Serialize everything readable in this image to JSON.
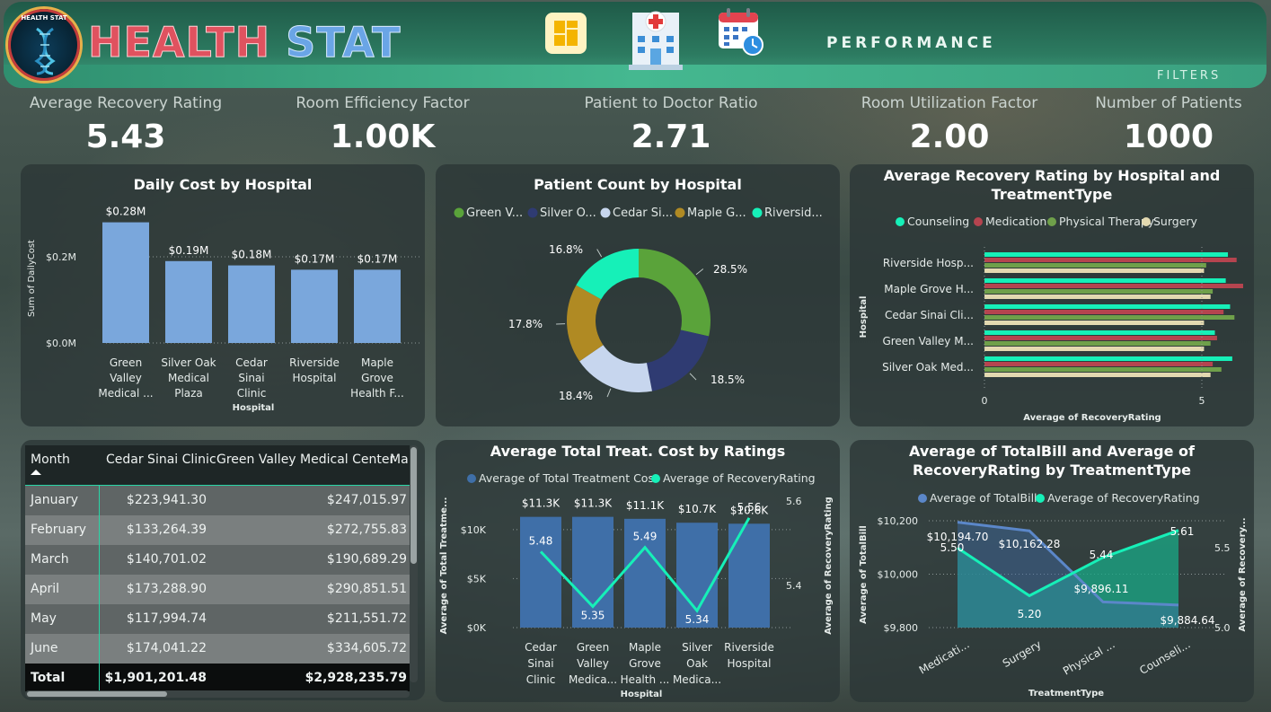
{
  "header": {
    "logo_text": "HEALTH STAT",
    "brand_part1": "HEALTH",
    "brand_part2": "STAT",
    "nav_icons": [
      "dashboard-icon",
      "hospital-icon",
      "calendar-icon"
    ],
    "page_title": "PERFORMANCE",
    "filters_label": "FILTERS",
    "colors": {
      "brand_red": "#e0525f",
      "brand_blue": "#6aa5e6",
      "header_green": "#2c7a60"
    }
  },
  "kpis": [
    {
      "label": "Average Recovery Rating",
      "value": "5.43"
    },
    {
      "label": "Room Efficiency Factor",
      "value": "1.00K"
    },
    {
      "label": "Patient to Doctor Ratio",
      "value": "2.71"
    },
    {
      "label": "Room Utilization Factor",
      "value": "2.00"
    },
    {
      "label": "Number of Patients",
      "value": "1000"
    }
  ],
  "chart_data": [
    {
      "type": "bar",
      "title": "Daily Cost by Hospital",
      "xlabel": "Hospital",
      "ylabel": "Sum of DailyCost",
      "categories": [
        [
          "Green",
          "Valley",
          "Medical ..."
        ],
        [
          "Silver Oak",
          "Medical",
          "Plaza"
        ],
        [
          "Cedar",
          "Sinai",
          "Clinic"
        ],
        [
          "Riverside",
          "Hospital"
        ],
        [
          "Maple",
          "Grove",
          "Health F..."
        ]
      ],
      "values": [
        0.28,
        0.19,
        0.18,
        0.17,
        0.17
      ],
      "data_labels": [
        "$0.28M",
        "$0.19M",
        "$0.18M",
        "$0.17M",
        "$0.17M"
      ],
      "y_ticks": [
        {
          "v": 0,
          "label": "$0.0M"
        },
        {
          "v": 0.2,
          "label": "$0.2M"
        }
      ],
      "ylim": [
        0,
        0.3
      ],
      "color": "#7aa7dc"
    },
    {
      "type": "pie",
      "title": "Patient Count by Hospital",
      "legend": [
        "Green V...",
        "Silver O...",
        "Cedar Si...",
        "Maple G...",
        "Riversid..."
      ],
      "values": [
        28.5,
        18.5,
        18.4,
        17.8,
        16.8
      ],
      "data_labels": [
        "28.5%",
        "18.5%",
        "18.4%",
        "17.8%",
        "16.8%"
      ],
      "colors": [
        "#5aa33a",
        "#2f3b72",
        "#c7d6ee",
        "#b08a23",
        "#16f0b8"
      ]
    },
    {
      "type": "bar",
      "orientation": "horizontal",
      "title": "Average Recovery Rating by Hospital and TreatmentType",
      "xlabel": "Average of RecoveryRating",
      "ylabel": "Hospital",
      "categories": [
        "Riverside Hosp...",
        "Maple Grove H...",
        "Cedar Sinai Cli...",
        "Green Valley M...",
        "Silver Oak Med..."
      ],
      "series": [
        {
          "name": "Counseling",
          "color": "#16f0b8",
          "values": [
            5.6,
            5.55,
            5.65,
            5.3,
            5.7
          ]
        },
        {
          "name": "Medication",
          "color": "#b5444f",
          "values": [
            5.8,
            5.95,
            5.5,
            5.35,
            5.25
          ]
        },
        {
          "name": "Physical Therapy",
          "color": "#6fa04a",
          "values": [
            5.1,
            5.25,
            5.75,
            5.2,
            5.45
          ]
        },
        {
          "name": "Surgery",
          "color": "#e3d9b0",
          "values": [
            5.05,
            5.2,
            5.05,
            5.05,
            5.2
          ]
        }
      ],
      "x_ticks": [
        0,
        5
      ],
      "xlim": [
        0,
        6
      ]
    },
    {
      "type": "bar",
      "title": "Average Total Treat. Cost by Ratings",
      "xlabel": "Hospital",
      "ylabel": "Average of Total Treatme...",
      "ylabel_right": "Average of RecoveryRating",
      "legend": [
        "Average of Total Treatment Cost",
        "Average of RecoveryRating"
      ],
      "categories": [
        [
          "Cedar",
          "Sinai",
          "Clinic"
        ],
        [
          "Green",
          "Valley",
          "Medica..."
        ],
        [
          "Maple",
          "Grove",
          "Health ..."
        ],
        [
          "Silver",
          "Oak",
          "Medica..."
        ],
        [
          "Riverside",
          "Hospital"
        ]
      ],
      "bar_values": [
        11300,
        11300,
        11100,
        10700,
        10600
      ],
      "bar_labels": [
        "$11.3K",
        "$11.3K",
        "$11.1K",
        "$10.7K",
        "$10.6K"
      ],
      "line_values": [
        5.48,
        5.35,
        5.49,
        5.34,
        5.56
      ],
      "line_labels": [
        "5.48",
        "5.35",
        "5.49",
        "5.34",
        "5.56"
      ],
      "y_ticks": [
        {
          "v": 0,
          "label": "$0K"
        },
        {
          "v": 5000,
          "label": "$5K"
        },
        {
          "v": 10000,
          "label": "$10K"
        }
      ],
      "y2_ticks": [
        {
          "v": 5.4,
          "label": "5.4"
        },
        {
          "v": 5.6,
          "label": "5.6"
        }
      ],
      "ylim": [
        0,
        12000
      ],
      "y2lim": [
        5.3,
        5.6
      ],
      "bar_color": "#3f6fa8",
      "line_color": "#16f0b8"
    },
    {
      "type": "area",
      "title": "Average of TotalBill and Average of RecoveryRating by TreatmentType",
      "xlabel": "TreatmentType",
      "ylabel": "Average of TotalBill",
      "ylabel_right": "Average of Recovery...",
      "legend": [
        "Average of TotalBill",
        "Average of RecoveryRating"
      ],
      "categories": [
        "Medicati...",
        "Surgery",
        "Physical ...",
        "Counseli..."
      ],
      "bill_values": [
        10194.7,
        10162.28,
        9896.11,
        9884.64
      ],
      "bill_labels": [
        "$10,194.70",
        "$10,162.28",
        "$9,896.11",
        "$9,884.64"
      ],
      "rating_values": [
        5.5,
        5.2,
        5.44,
        5.61
      ],
      "rating_labels": [
        "5.50",
        "5.20",
        "5.44",
        "5.61"
      ],
      "y_ticks": [
        {
          "v": 9800,
          "label": "$9,800"
        },
        {
          "v": 10000,
          "label": "$10,000"
        },
        {
          "v": 10200,
          "label": "$10,200"
        }
      ],
      "y2_ticks": [
        {
          "v": 5.0,
          "label": "5.0"
        },
        {
          "v": 5.5,
          "label": "5.5"
        }
      ],
      "ylim": [
        9800,
        10200
      ],
      "y2lim": [
        5.0,
        5.67
      ],
      "bill_color": "#5b87c9",
      "rating_color": "#16f0b8"
    }
  ],
  "table": {
    "columns": [
      "Month",
      "Cedar Sinai Clinic",
      "Green Valley Medical Center",
      "Ma"
    ],
    "rows": [
      [
        "January",
        "$223,941.30",
        "$247,015.97"
      ],
      [
        "February",
        "$133,264.39",
        "$272,755.83"
      ],
      [
        "March",
        "$140,701.02",
        "$190,689.29"
      ],
      [
        "April",
        "$173,288.90",
        "$290,851.51"
      ],
      [
        "May",
        "$117,994.74",
        "$211,551.72"
      ],
      [
        "June",
        "$174,041.22",
        "$334,605.72"
      ]
    ],
    "total": [
      "Total",
      "$1,901,201.48",
      "$2,928,235.79"
    ]
  }
}
